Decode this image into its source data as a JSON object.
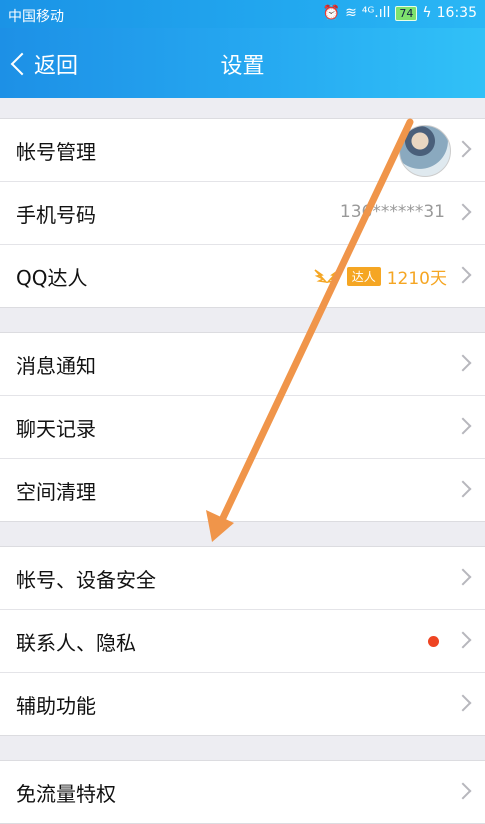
{
  "status_bar": {
    "carrier": "中国移动",
    "signal_text": "⁴ᴳ.ıll",
    "battery": "74",
    "time": "16:35"
  },
  "nav": {
    "back_label": "返回",
    "title": "设置"
  },
  "groups": [
    {
      "items": [
        {
          "label": "帐号管理"
        },
        {
          "label": "手机号码",
          "value": "136******31"
        },
        {
          "label": "QQ达人",
          "badge": "达人",
          "days": "1210天"
        }
      ]
    },
    {
      "items": [
        {
          "label": "消息通知"
        },
        {
          "label": "聊天记录"
        },
        {
          "label": "空间清理"
        }
      ]
    },
    {
      "items": [
        {
          "label": "帐号、设备安全"
        },
        {
          "label": "联系人、隐私"
        },
        {
          "label": "辅助功能"
        }
      ]
    },
    {
      "items": [
        {
          "label": "免流量特权"
        }
      ]
    }
  ],
  "colors": {
    "accent": "#26a9f1",
    "badge": "#f5a623",
    "dot": "#ee4422",
    "annotation_arrow": "#f0954a"
  }
}
